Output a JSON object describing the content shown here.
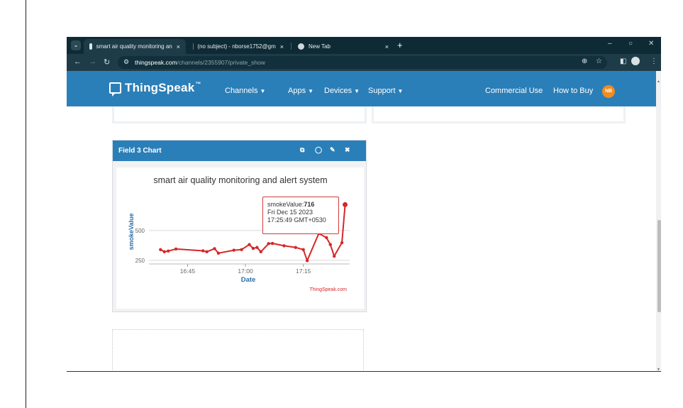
{
  "browser": {
    "tabs": [
      {
        "title": "smart air quality monitoring an",
        "active": true
      },
      {
        "title": "(no subject) - nborse1752@gm",
        "active": false
      },
      {
        "title": "New Tab",
        "active": false
      }
    ],
    "tab_close": "×",
    "new_tab": "+",
    "url_host": "thingspeak.com",
    "url_path": "/channels/2355907/private_show"
  },
  "site": {
    "logo": "ThingSpeak",
    "logo_tm": "™",
    "nav": [
      {
        "label": "Channels",
        "caret": "▼"
      },
      {
        "label": "Apps",
        "caret": "▼"
      },
      {
        "label": "Devices",
        "caret": "▼"
      },
      {
        "label": "Support",
        "caret": "▼"
      }
    ],
    "commercial": "Commercial Use",
    "buy": "How to Buy",
    "user_initials": "NB"
  },
  "card": {
    "title": "Field 3 Chart"
  },
  "chart_data": {
    "type": "line",
    "title": "smart air quality monitoring and alert system",
    "xlabel": "Date",
    "ylabel": "smokeValue",
    "x_ticks": [
      "16:45",
      "17:00",
      "17:15"
    ],
    "y_ticks": [
      250,
      500
    ],
    "ylim": [
      220,
      760
    ],
    "credit": "ThingSpeak.com",
    "line_color": "#d62728",
    "series": [
      {
        "points": [
          {
            "t": "16:38",
            "v": 340
          },
          {
            "t": "16:39",
            "v": 322
          },
          {
            "t": "16:40",
            "v": 328
          },
          {
            "t": "16:42",
            "v": 345
          },
          {
            "t": "16:49",
            "v": 330
          },
          {
            "t": "16:50",
            "v": 322
          },
          {
            "t": "16:52",
            "v": 348
          },
          {
            "t": "16:53",
            "v": 310
          },
          {
            "t": "16:57",
            "v": 335
          },
          {
            "t": "16:59",
            "v": 340
          },
          {
            "t": "17:01",
            "v": 382
          },
          {
            "t": "17:02",
            "v": 350
          },
          {
            "t": "17:03",
            "v": 358
          },
          {
            "t": "17:04",
            "v": 322
          },
          {
            "t": "17:06",
            "v": 390
          },
          {
            "t": "17:07",
            "v": 392
          },
          {
            "t": "17:10",
            "v": 372
          },
          {
            "t": "17:13",
            "v": 358
          },
          {
            "t": "17:15",
            "v": 340
          },
          {
            "t": "17:16",
            "v": 248
          },
          {
            "t": "17:19",
            "v": 475
          },
          {
            "t": "17:21",
            "v": 440
          },
          {
            "t": "17:22",
            "v": 382
          },
          {
            "t": "17:23",
            "v": 285
          },
          {
            "t": "17:25",
            "v": 398
          },
          {
            "t": "17:25:49",
            "v": 716
          }
        ]
      }
    ],
    "tooltip": {
      "label": "smokeValue:",
      "value": "716",
      "date": "Fri Dec 15 2023",
      "time": "17:25:49 GMT+0530"
    }
  }
}
